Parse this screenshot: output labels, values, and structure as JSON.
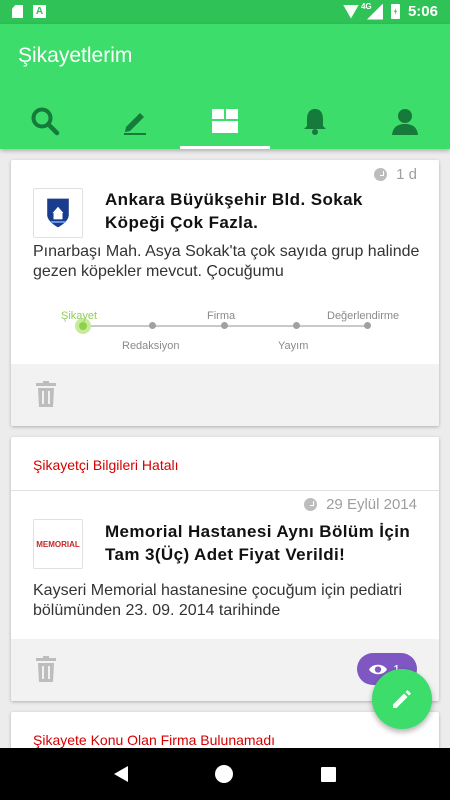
{
  "status_bar": {
    "time": "5:06",
    "network": "4G",
    "colors": {
      "background": "#2fc257"
    }
  },
  "app_bar": {
    "title": "Şikayetlerim",
    "color": "#3ddd6c",
    "tabs": [
      {
        "icon": "search-icon"
      },
      {
        "icon": "pencil-icon"
      },
      {
        "icon": "dashboard-icon",
        "active": true
      },
      {
        "icon": "bell-icon"
      },
      {
        "icon": "person-icon"
      }
    ]
  },
  "complaints": [
    {
      "time": "1 d",
      "logo": "ankara-bb-logo",
      "title": "Ankara Büyükşehir Bld. Sokak Köpeği Çok Fazla.",
      "description": "Pınarbaşı Mah. Asya Sokak'ta çok sayıda grup halinde gezen köpekler mevcut. Çocuğumu",
      "progress": {
        "current_step": 0,
        "steps": [
          "Şikayet",
          "Redaksiyon",
          "Firma",
          "Yayım",
          "Değerlendirme"
        ]
      }
    },
    {
      "alert": "Şikayetçi Bilgileri Hatalı",
      "time": "29 Eylül 2014",
      "logo_text": "MEMORIAL",
      "title": " Memorial Hastanesi Aynı Bölüm İçin Tam 3(Üç) Adet Fiyat Verildi!",
      "description": "Kayseri Memorial hastanesine çocuğum için pediatri bölümünden 23. 09. 2014 tarihinde",
      "views": "1"
    },
    {
      "alert": "Şikayete Konu Olan Firma Bulunamadı"
    }
  ],
  "fab": {
    "icon": "edit-icon"
  },
  "nav_bar": {
    "icons": [
      "back-icon",
      "home-icon",
      "recents-icon"
    ]
  }
}
